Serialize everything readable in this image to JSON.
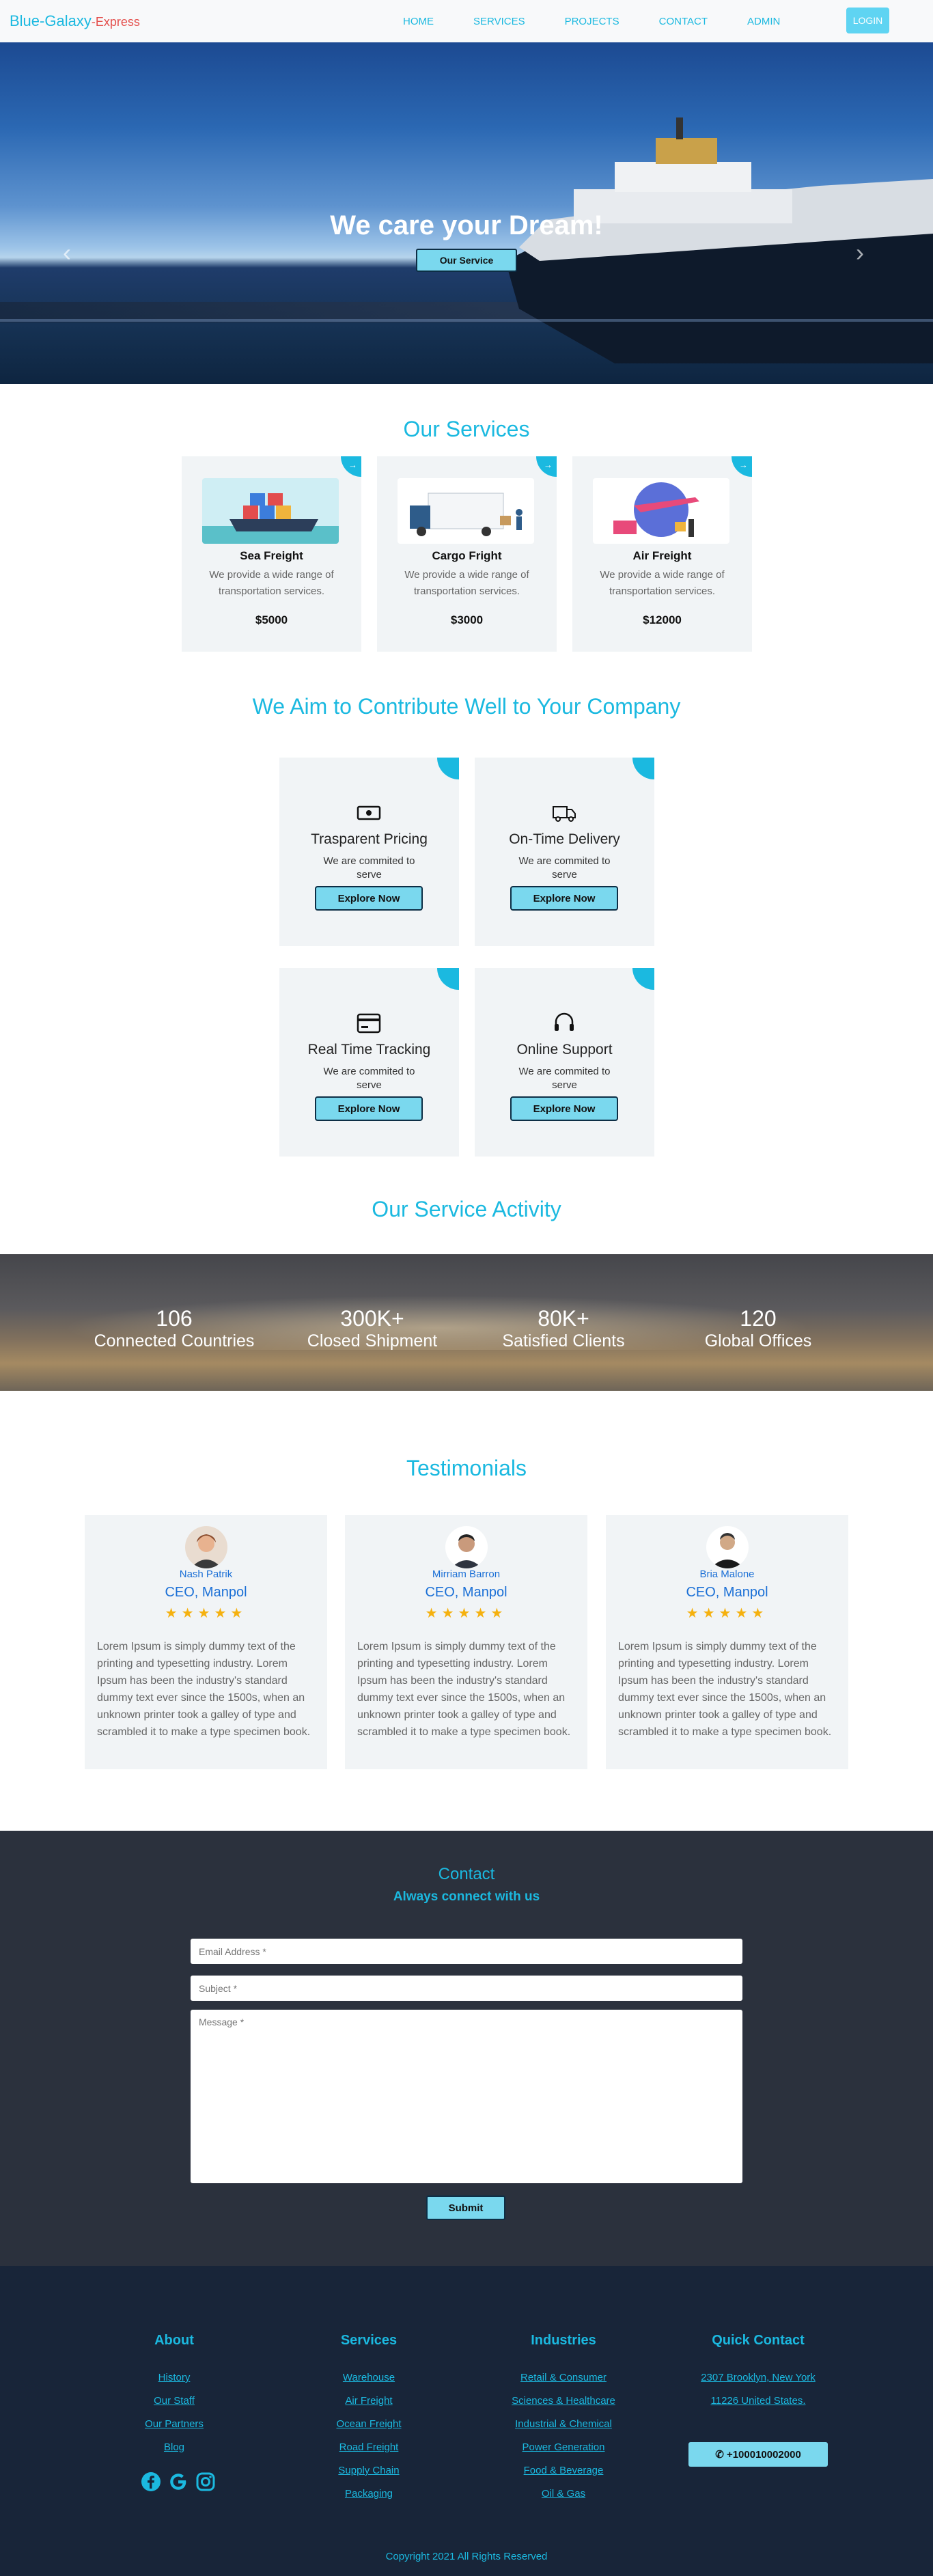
{
  "nav": {
    "brand_main": "Blue-Galaxy",
    "brand_suffix": "-Express",
    "links": [
      "HOME",
      "SERVICES",
      "PROJECTS",
      "CONTACT",
      "ADMIN"
    ],
    "login": "LOGIN"
  },
  "hero": {
    "title": "We care your Dream!",
    "button": "Our Service",
    "prev_icon": "chevron-left",
    "next_icon": "chevron-right"
  },
  "services": {
    "heading": "Our Services",
    "items": [
      {
        "title": "Sea Freight",
        "desc": "We provide a wide range of transportation services.",
        "price": "$5000",
        "corner": "→"
      },
      {
        "title": "Cargo Fright",
        "desc": "We provide a wide range of transportation services.",
        "price": "$3000",
        "corner": "→"
      },
      {
        "title": "Air Freight",
        "desc": "We provide a wide range of transportation services.",
        "price": "$12000",
        "corner": "→"
      }
    ]
  },
  "features": {
    "heading": "We Aim to Contribute Well to Your Company",
    "items": [
      {
        "title": "Trasparent Pricing",
        "desc": "We are commited to serve",
        "button": "Explore Now",
        "icon": "money-icon"
      },
      {
        "title": "On-Time Delivery",
        "desc": "We are commited to serve",
        "button": "Explore Now",
        "icon": "truck-icon"
      },
      {
        "title": "Real Time Tracking",
        "desc": "We are commited to serve",
        "button": "Explore Now",
        "icon": "card-icon"
      },
      {
        "title": "Online Support",
        "desc": "We are commited to serve",
        "button": "Explore Now",
        "icon": "headset-icon"
      }
    ]
  },
  "activity": {
    "heading": "Our Service Activity",
    "stats": [
      {
        "num": "106",
        "label": "Connected Countries"
      },
      {
        "num": "300K+",
        "label": "Closed Shipment"
      },
      {
        "num": "80K+",
        "label": "Satisfied Clients"
      },
      {
        "num": "120",
        "label": "Global Offices"
      }
    ]
  },
  "testimonials": {
    "heading": "Testimonials",
    "items": [
      {
        "name": "Nash Patrik",
        "role": "CEO, Manpol",
        "stars": "★★★★★",
        "text": "Lorem Ipsum is simply dummy text of the printing and typesetting industry. Lorem Ipsum has been the industry's standard dummy text ever since the 1500s, when an unknown printer took a galley of type and scrambled it to make a type specimen book."
      },
      {
        "name": "Mirriam Barron",
        "role": "CEO, Manpol",
        "stars": "★★★★★",
        "text": "Lorem Ipsum is simply dummy text of the printing and typesetting industry. Lorem Ipsum has been the industry's standard dummy text ever since the 1500s, when an unknown printer took a galley of type and scrambled it to make a type specimen book."
      },
      {
        "name": "Bria Malone",
        "role": "CEO, Manpol",
        "stars": "★★★★★",
        "text": "Lorem Ipsum is simply dummy text of the printing and typesetting industry. Lorem Ipsum has been the industry's standard dummy text ever since the 1500s, when an unknown printer took a galley of type and scrambled it to make a type specimen book."
      }
    ]
  },
  "contact": {
    "title": "Contact",
    "subtitle": "Always connect with us",
    "email_placeholder": "Email Address *",
    "subject_placeholder": "Subject *",
    "message_placeholder": "Message *",
    "submit": "Submit"
  },
  "footer": {
    "about": {
      "heading": "About",
      "links": [
        "History",
        "Our Staff",
        "Our Partners",
        "Blog"
      ]
    },
    "services": {
      "heading": "Services",
      "links": [
        "Warehouse",
        "Air Freight",
        "Ocean Freight",
        "Road Freight",
        "Supply Chain",
        "Packaging"
      ]
    },
    "industries": {
      "heading": "Industries",
      "links": [
        "Retail & Consumer",
        "Sciences & Healthcare",
        "Industrial & Chemical",
        "Power Generation",
        "Food & Beverage",
        "Oil & Gas"
      ]
    },
    "quick": {
      "heading": "Quick Contact",
      "links": [
        "2307 Brooklyn, New York",
        "11226 United States."
      ],
      "phone": "+100010002000"
    },
    "socials": [
      "facebook-icon",
      "google-icon",
      "instagram-icon"
    ],
    "copyright": "Copyright 2021 All Rights Reserved"
  },
  "colors": {
    "accent": "#1bb9e0",
    "button": "#7ad8ee",
    "contact_bg": "#2b313d",
    "footer_bg": "#182539",
    "card_bg": "#f1f4f6",
    "brand_red": "#e4504d"
  }
}
